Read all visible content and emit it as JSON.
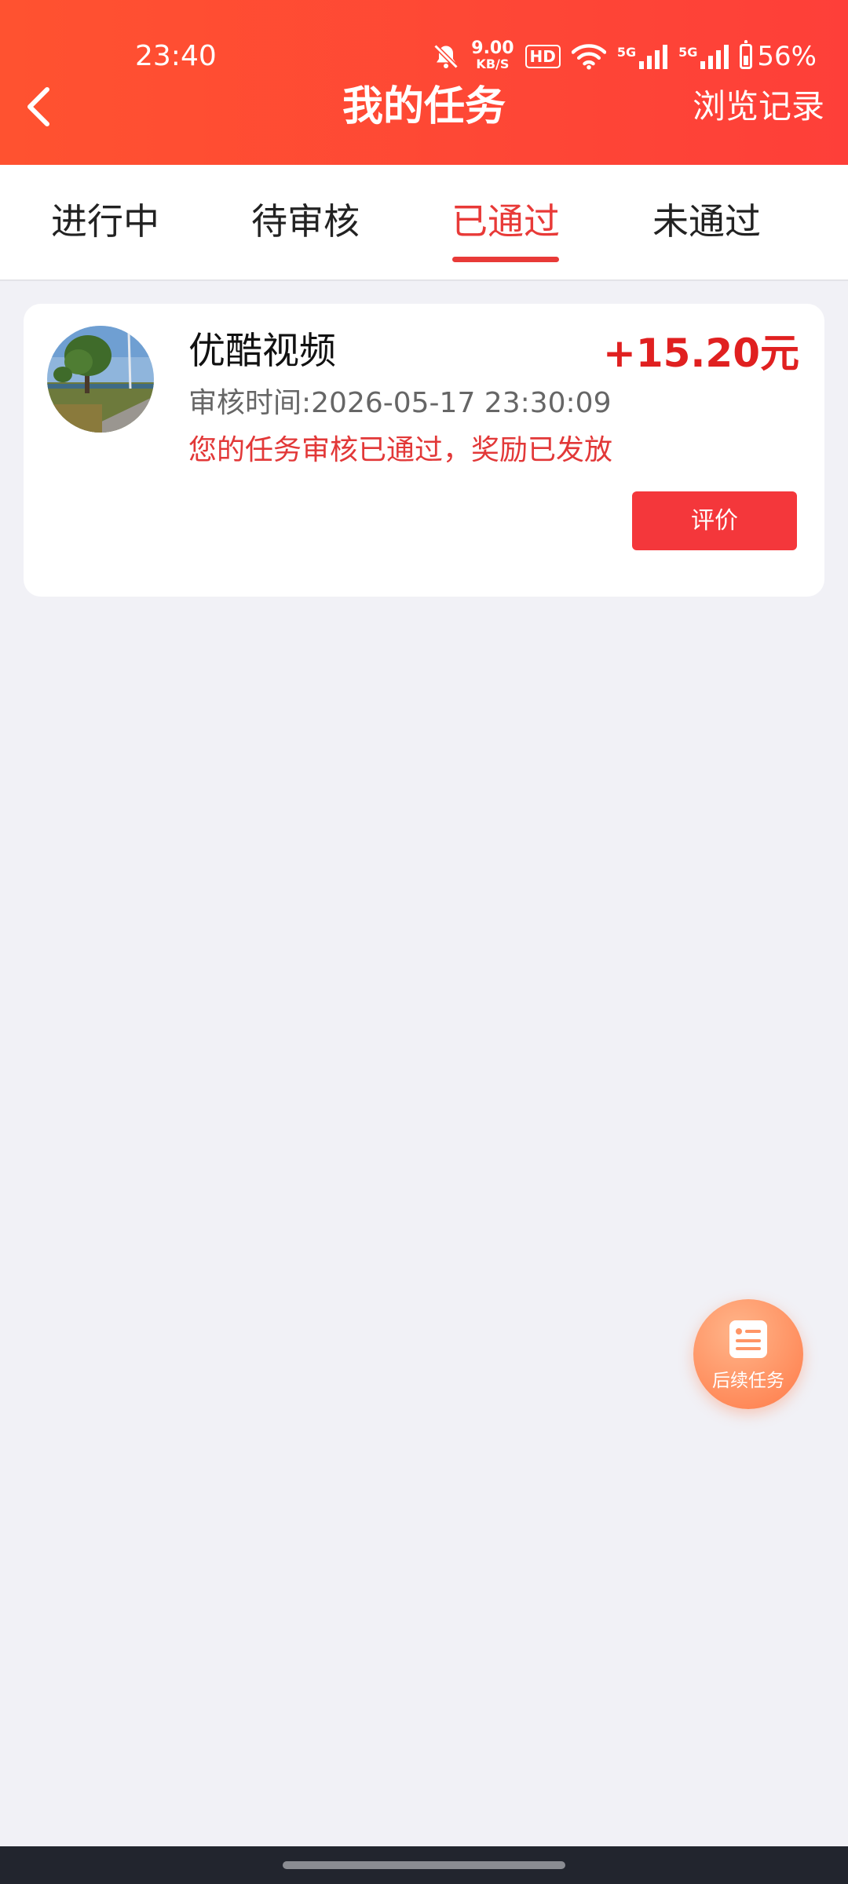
{
  "status_bar": {
    "time": "23:40",
    "net_speed_value": "9.00",
    "net_speed_unit": "KB/S",
    "hd_label": "HD",
    "signal_1_label": "5G",
    "signal_2_label": "5G",
    "battery_percent": "56%",
    "battery_level": 0.56
  },
  "header": {
    "title": "我的任务",
    "right_link": "浏览记录"
  },
  "tabs": {
    "items": [
      {
        "label": "进行中"
      },
      {
        "label": "待审核"
      },
      {
        "label": "已通过"
      },
      {
        "label": "未通过"
      }
    ],
    "active_index": 2
  },
  "task_card": {
    "name": "优酷视频",
    "reward": "+15.20元",
    "review_time": "审核时间:2026-05-17 23:30:09",
    "status_message": "您的任务审核已通过，奖励已发放",
    "rate_button": "评价"
  },
  "fab": {
    "label": "后续任务"
  },
  "colors": {
    "header_start": "#ff5230",
    "header_end": "#fe3f39",
    "accent_red": "#e83a38",
    "reward_red": "#e02020",
    "button_red": "#f4373b",
    "fab_orange": "#ff9566",
    "page_bg": "#f1f1f6"
  }
}
